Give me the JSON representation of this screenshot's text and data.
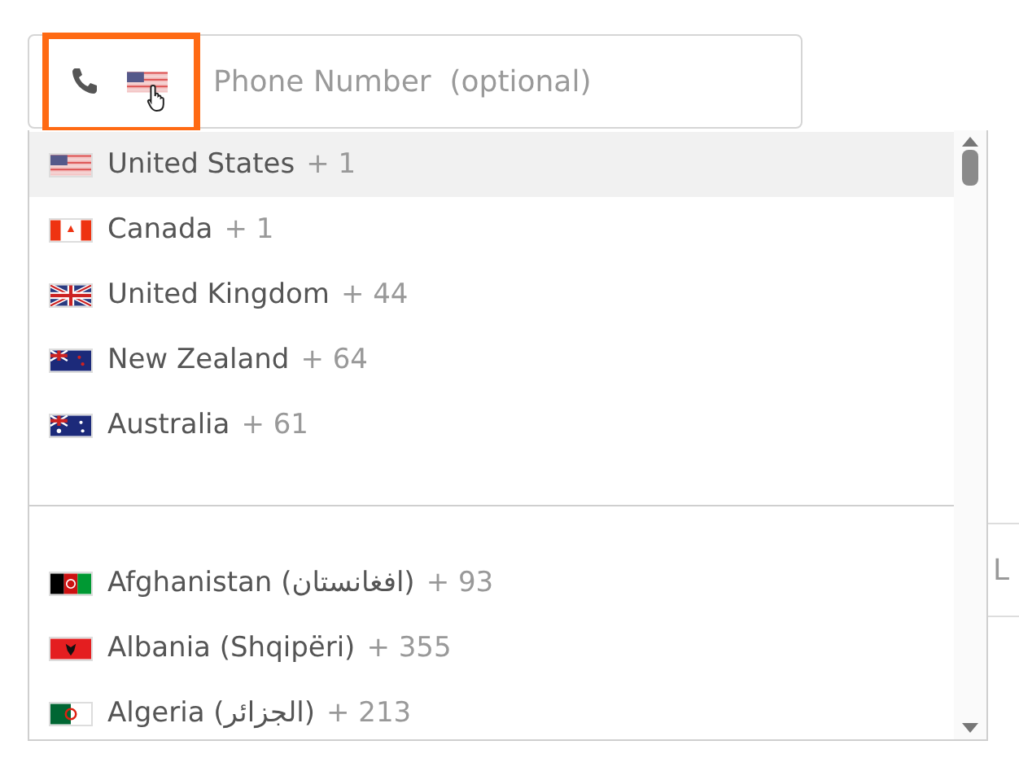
{
  "phone_field": {
    "kind": "us",
    "placeholder": "Phone Number  (optional)",
    "highlighted": true
  },
  "dropdown": {
    "countries": [
      {
        "kind": "us",
        "name": "United States",
        "code": "+ 1",
        "selected": true
      },
      {
        "kind": "ca",
        "name": "Canada",
        "code": "+ 1",
        "selected": false
      },
      {
        "kind": "gb",
        "name": "United Kingdom",
        "code": "+ 44",
        "selected": false
      },
      {
        "kind": "nz",
        "name": "New Zealand",
        "code": "+ 64",
        "selected": false
      },
      {
        "kind": "au",
        "name": "Australia",
        "code": "+ 61",
        "selected": false
      },
      {
        "kind": "divider"
      },
      {
        "kind": "af",
        "name": "Afghanistan (افغانستان)",
        "code": "+ 93",
        "selected": false
      },
      {
        "kind": "al",
        "name": "Albania (Shqipëri)",
        "code": "+ 355",
        "selected": false
      },
      {
        "kind": "dz",
        "name": "Algeria (الجزائر)",
        "code": "+ 213",
        "selected": false
      }
    ]
  },
  "background_field": {
    "value": "L"
  }
}
